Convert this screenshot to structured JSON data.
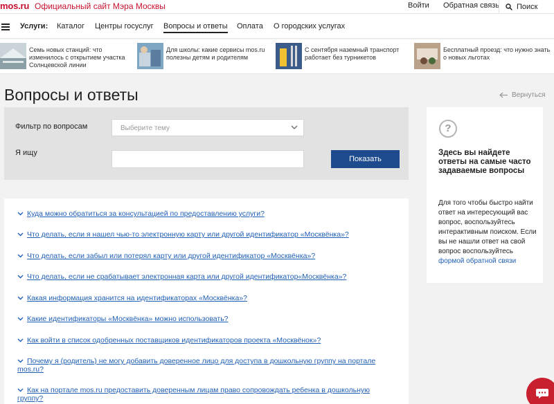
{
  "header": {
    "logo": "mos.ru",
    "subtitle": "Официальный сайт Мэра Москвы",
    "login": "Войти",
    "feedback": "Обратная связь",
    "search": "Поиск"
  },
  "nav": {
    "services_label": "Услуги:",
    "items": [
      {
        "label": "Каталог"
      },
      {
        "label": "Центры госуслуг"
      },
      {
        "label": "Вопросы и ответы",
        "active": true
      },
      {
        "label": "Оплата"
      },
      {
        "label": "О городских услугах"
      }
    ]
  },
  "news": [
    {
      "text": "Семь новых станций: что изменилось с открытием участка Солнцевской линии"
    },
    {
      "text": "Для школы: какие сервисы mos.ru полезны детям и родителям"
    },
    {
      "text": "С сентября наземный транспорт работает без турникетов"
    },
    {
      "text": "Бесплатный проезд: что нужно знать о новых льготах"
    }
  ],
  "page": {
    "title": "Вопросы и ответы",
    "back": "Вернуться"
  },
  "filter": {
    "topic_label": "Фильтр по вопросам",
    "topic_placeholder": "Выберите тему",
    "search_label": "Я ищу",
    "search_value": "",
    "button": "Показать"
  },
  "questions": [
    "Куда можно обратиться за консультацией по предоставлению услуги?",
    "Что делать, если я нашел чью-то электронную карту или другой идентификатор «Москвёнка»?",
    "Что делать, если забыл или потерял карту или другой идентификатор «Москвёнка»?",
    "Что делать, если не срабатывает электронная карта или другой идентификатор«Москвёнка»?",
    "Какая информация хранится на идентификаторах «Москвёнка»?",
    "Какие идентификаторы «Москвёнка» можно использовать?",
    "Как войти в список одобренных поставщиков идентификаторов проекта «Москвёнок»?",
    "Почему я (родитель) не могу добавить доверенное лицо для доступа в дошкольную группу на портале mos.ru?",
    "Как на портале mos.ru предоставить доверенным лицам право сопровождать ребенка в дошкольную группу?"
  ],
  "sidebar": {
    "icon_text": "?",
    "title": "Здесь вы найдете ответы на самые часто задаваемые вопросы",
    "text": "Для того чтобы быстро найти ответ на интересующий вас вопрос, воспользуйтесь интерактивным поиском. Если вы не нашли ответ на свой вопрос воспользуйтесь",
    "link": "формой обратной связи"
  },
  "colors": {
    "brand_red": "#c8102e",
    "link_blue": "#1f5fb5",
    "button_blue": "#1e4b8e"
  }
}
